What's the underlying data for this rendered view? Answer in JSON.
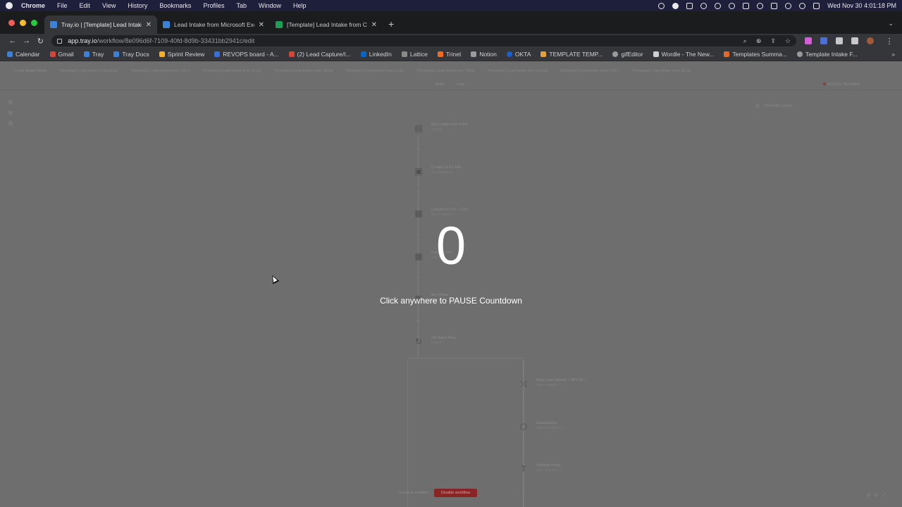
{
  "menubar": {
    "app_name": "Chrome",
    "items": [
      "File",
      "Edit",
      "View",
      "History",
      "Bookmarks",
      "Profiles",
      "Tab",
      "Window",
      "Help"
    ],
    "clock": "Wed Nov 30  4:01:18 PM"
  },
  "tabs": [
    {
      "label": "Tray.io | [Template] Lead Intake",
      "active": true
    },
    {
      "label": "Lead Intake from Microsoft Excel",
      "active": false
    },
    {
      "label": "[Template] Lead Intake from CSV",
      "active": false
    }
  ],
  "toolbar": {
    "url_host": "app.tray.io",
    "url_path": "/workflow/8e096d6f-7109-40fd-8d9b-33431bb2941c/edit"
  },
  "bookmarks": [
    {
      "label": "Calendar",
      "color": "#3b82d6"
    },
    {
      "label": "Gmail",
      "color": "#d44638"
    },
    {
      "label": "Tray",
      "color": "#3b82d6"
    },
    {
      "label": "Tray Docs",
      "color": "#3b82d6"
    },
    {
      "label": "Sprint Review",
      "color": "#f1b12d"
    },
    {
      "label": "REVOPS board - A...",
      "color": "#3b6fd8"
    },
    {
      "label": "(2) Lead Capture/I...",
      "color": "#d44638"
    },
    {
      "label": "LinkedIn",
      "color": "#0a66c2"
    },
    {
      "label": "Lattice",
      "color": "#8a8a8a"
    },
    {
      "label": "Trinet",
      "color": "#f26b21"
    },
    {
      "label": "Notion",
      "color": "#9a9a9a"
    },
    {
      "label": "OKTA",
      "color": "#1a5fd0"
    },
    {
      "label": "TEMPLATE TEMP...",
      "color": "#e2a03a"
    },
    {
      "label": "gifEditor",
      "color": "#9a9a9a"
    },
    {
      "label": "Wordle - The New...",
      "color": "#d0d0d0"
    },
    {
      "label": "Templates Summa...",
      "color": "#e36a2d"
    },
    {
      "label": "Template Intake F...",
      "color": "#9a9a9a"
    }
  ],
  "page": {
    "tabs": [
      "Lead Intake Temp",
      "[Template] Lead Intake to Destinat",
      "[Template] Lead Intake from CSV f",
      "[Template] Lead Intake from XLSX",
      "[Template] Lead Intake from GShe",
      "[Template] Lead Intake from Linke",
      "[Template] Lead Intake from Webi",
      "[Template] Lead Intake from Faceb",
      "[Template] Lead Intake from CSV f",
      "[Template] Lead Intake from XLSX"
    ],
    "build_label": "Build",
    "logs_label": "Logs",
    "templates_label": "RevOps Templates",
    "properties_label": "Properties panel",
    "steps": [
      {
        "title": "Get Leads from Form",
        "sub": "trigger"
      },
      {
        "title": "Create XLSX File",
        "sub": "file-helpers-1"
      },
      {
        "title": "Convert XLSX > CSV",
        "sub": "xlsx-helpers-1"
      },
      {
        "title": "Create CSV",
        "sub": "csv-1"
      },
      {
        "title": "Get Rows",
        "sub": "csv-2"
      },
      {
        "title": "For Each Row",
        "sub": "loop-1"
      },
      {
        "title": "Map Lead Source > API Va...",
        "sub": "data-mapper-1"
      },
      {
        "title": "Standardize",
        "sub": "object-helpers-1"
      },
      {
        "title": "Validate Email",
        "sub": "text-helpers-1"
      }
    ],
    "saved_label": "Saved & enabled",
    "disable_label": "Disable workflow"
  },
  "overlay": {
    "countdown": "0",
    "message": "Click anywhere to PAUSE Countdown"
  }
}
